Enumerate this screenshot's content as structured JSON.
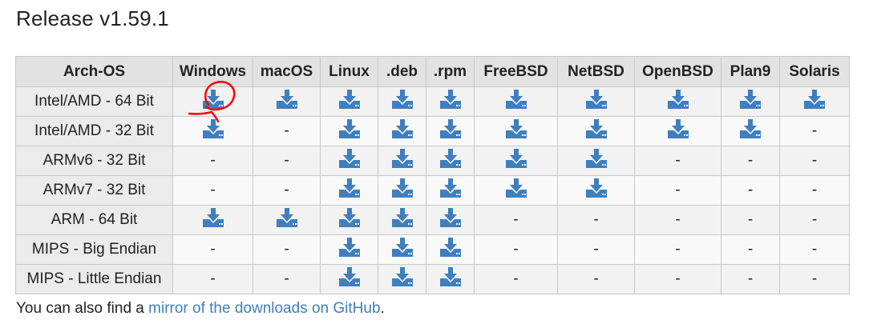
{
  "page": {
    "title": "Release v1.59.1"
  },
  "table": {
    "columns": [
      "Arch-OS",
      "Windows",
      "macOS",
      "Linux",
      ".deb",
      ".rpm",
      "FreeBSD",
      "NetBSD",
      "OpenBSD",
      "Plan9",
      "Solaris"
    ],
    "rows": [
      {
        "arch": "Intel/AMD - 64 Bit",
        "cells": [
          true,
          true,
          true,
          true,
          true,
          true,
          true,
          true,
          true,
          true
        ]
      },
      {
        "arch": "Intel/AMD - 32 Bit",
        "cells": [
          true,
          false,
          true,
          true,
          true,
          true,
          true,
          true,
          true,
          false
        ]
      },
      {
        "arch": "ARMv6 - 32 Bit",
        "cells": [
          false,
          false,
          true,
          true,
          true,
          true,
          true,
          false,
          false,
          false
        ]
      },
      {
        "arch": "ARMv7 - 32 Bit",
        "cells": [
          false,
          false,
          true,
          true,
          true,
          true,
          true,
          false,
          false,
          false
        ]
      },
      {
        "arch": "ARM - 64 Bit",
        "cells": [
          true,
          true,
          true,
          true,
          true,
          false,
          false,
          false,
          false,
          false
        ]
      },
      {
        "arch": "MIPS - Big Endian",
        "cells": [
          false,
          false,
          true,
          true,
          true,
          false,
          false,
          false,
          false,
          false
        ]
      },
      {
        "arch": "MIPS - Little Endian",
        "cells": [
          false,
          false,
          true,
          true,
          true,
          false,
          false,
          false,
          false,
          false
        ]
      }
    ],
    "unavailable_text": "-",
    "download_icon": "download-icon",
    "icon_color": "#3f7fbf"
  },
  "footer": {
    "prefix": "You can also find a ",
    "link_text": "mirror of the downloads on GitHub",
    "suffix": "."
  },
  "annotation": {
    "icon": "red-circle-annotation",
    "color": "#ff0000"
  }
}
